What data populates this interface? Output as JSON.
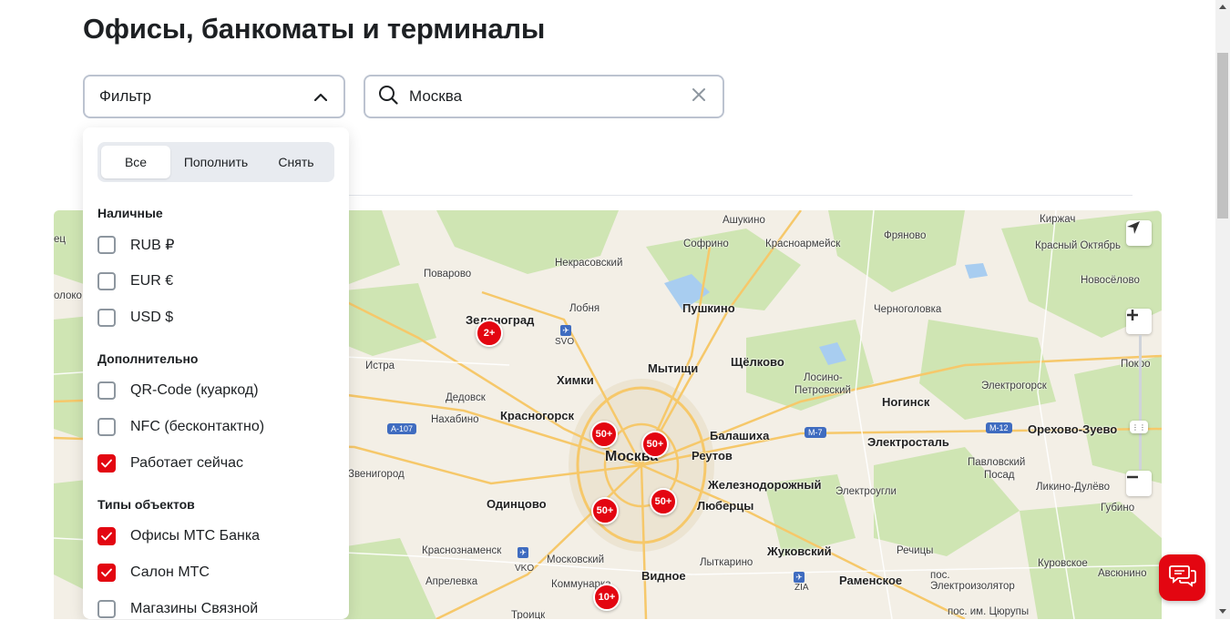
{
  "page": {
    "title": "Офисы, банкоматы и терминалы"
  },
  "filter": {
    "label": "Фильтр"
  },
  "search": {
    "value": "Москва"
  },
  "panel": {
    "segments": [
      "Все",
      "Пополнить",
      "Снять"
    ],
    "sections": {
      "cash": "Наличные",
      "extra": "Дополнительно",
      "types": "Типы объектов"
    },
    "cash_items": [
      "RUB ₽",
      "EUR €",
      "USD $"
    ],
    "extra_items": [
      "QR-Code (куаркод)",
      "NFC (бесконтактно)",
      "Работает сейчас"
    ],
    "type_items": [
      "Офисы МТС Банка",
      "Салон МТС",
      "Магазины Связной"
    ],
    "checked": {
      "RUB": false,
      "EUR": false,
      "USD": false,
      "QR": false,
      "NFC": false,
      "open_now": true,
      "mts_bank": true,
      "mts_salon": true,
      "svyaznoy": false
    }
  },
  "map": {
    "clusters": [
      "2+",
      "50+",
      "50+",
      "50+",
      "50+",
      "10+"
    ],
    "places": {
      "moscow": "Москва",
      "zelenograd": "Зеленоград",
      "khimki": "Химки",
      "mytishchi": "Мытищи",
      "pushkino": "Пушкино",
      "shchelkovo": "Щёлково",
      "balashikha": "Балашиха",
      "krasnogorsk": "Красногорск",
      "odintsovo": "Одинцово",
      "lyubertsy": "Люберцы",
      "zheleznodorozhny": "Железнодорожный",
      "reutov": "Реутов",
      "vidnoe": "Видное",
      "zhukovsky": "Жуковский",
      "ramenskoe": "Раменское",
      "noginsk": "Ногинск",
      "elektrostal": "Электросталь",
      "orekhovo": "Орехово-Зуево",
      "elektrogorsk": "Электрогорск",
      "pavlovsky": "Павловский",
      "pavlovsky2": "Посад",
      "likino": "Ликино-Дулёво",
      "gubino": "Губино",
      "kurovskoe": "Куровское",
      "elektrougli": "Электроугли",
      "losino": "Лосино-",
      "losino2": "Петровский",
      "chernogolovka": "Черноголовка",
      "fryanovo": "Фряново",
      "kirzhach": "Киржач",
      "krasny_oktyabr": "Красный Октябрь",
      "novoselovo": "Новосёлово",
      "ashukino": "Ашукино",
      "sofrino": "Софрино",
      "krasnoarmeysk": "Красноармейск",
      "nekrasovsky": "Некрасовский",
      "lobnya": "Лобня",
      "povarovo": "Поварово",
      "istra": "Истра",
      "dedovsk": "Дедовск",
      "nakhabino": "Нахабино",
      "zvenigorod": "Звенигород",
      "krasnoznamensk": "Краснознаменск",
      "aprelevka": "Апрелевка",
      "moskovsky": "Московский",
      "kommunarka": "Коммунарка",
      "lytkarino": "Лыткарино",
      "rechitsy": "Речицы",
      "pos": "пос.",
      "elektroizolyator": "Электроизолятор",
      "avsyunino": "Авсюнино",
      "tsyuruпy": "пос. им. Цюрупы",
      "troitsk": "Троицк",
      "svo": "SVO",
      "vko": "VKO",
      "zia": "ZIA",
      "pokrov": "Покро",
      "edge1": "ец",
      "edge2": "олоко"
    },
    "highways": [
      "A-107",
      "M-7",
      "M-12"
    ]
  },
  "colors": {
    "accent": "#e30611",
    "border": "#bcc3d0"
  },
  "icons": [
    "chevron-up-icon",
    "search-icon",
    "close-icon",
    "check-icon",
    "navigate-icon",
    "plus-icon",
    "minus-icon",
    "chat-icon",
    "airport-icon"
  ]
}
